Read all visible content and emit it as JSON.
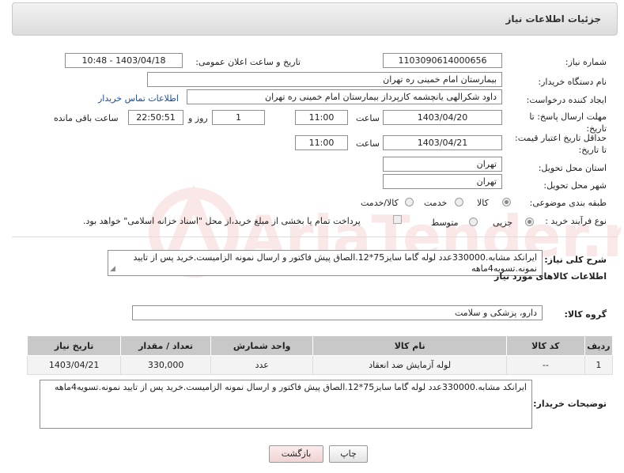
{
  "header": {
    "title": "جزئیات اطلاعات نیاز"
  },
  "form": {
    "need_number_label": "شماره نیاز:",
    "need_number": "1103090614000656",
    "announce_label": "تاریخ و ساعت اعلان عمومی:",
    "announce_value": "1403/04/18 - 10:48",
    "buyer_label": "نام دستگاه خریدار:",
    "buyer_value": "بیمارستان امام خمینی ره  تهران",
    "creator_label": "ایجاد کننده درخواست:",
    "creator_value": "داود شکرالهی یانچشمه کارپرداز بیمارستان امام خمینی ره  تهران",
    "contact_link": "اطلاعات تماس خریدار",
    "deadline_label": "مهلت ارسال پاسخ: تا تاریخ:",
    "deadline_date": "1403/04/20",
    "time_label": "ساعت",
    "deadline_time": "11:00",
    "days_value": "1",
    "day_and_label": "روز و",
    "remaining_time": "22:50:51",
    "remaining_label": "ساعت باقی مانده",
    "min_price_label": "حداقل تاریخ اعتبار قیمت: تا تاریخ:",
    "min_price_date": "1403/04/21",
    "min_price_time": "11:00",
    "province_label": "استان محل تحویل:",
    "province_value": "تهران",
    "city_label": "شهر محل تحویل:",
    "city_value": "تهران",
    "category_label": "طبقه بندی موضوعی:",
    "category_options": [
      "کالا",
      "خدمت",
      "کالا/خدمت"
    ],
    "category_selected": "کالا",
    "process_label": "نوع فرآیند خرید :",
    "process_options": [
      "جزیی",
      "متوسط"
    ],
    "process_selected": "جزیی",
    "payment_note": "پرداخت تمام یا بخشی از مبلغ خرید،از محل \"اسناد خزانه اسلامی\" خواهد بود."
  },
  "summary": {
    "label": "شرح کلی نیاز:",
    "text": "ایرانکد مشابه.330000عدد لوله گاما سایز75*12.الصاق پیش فاکتور و ارسال نمونه الزامیست.خرید پس از تایید نمونه.تسویه4ماهه"
  },
  "goods": {
    "section_title": "اطلاعات کالاهای مورد نیاز",
    "group_label": "گروه کالا:",
    "group_value": "دارو، پزشکی و سلامت",
    "columns": [
      "ردیف",
      "کد کالا",
      "نام کالا",
      "واحد شمارش",
      "تعداد / مقدار",
      "تاریخ نیاز"
    ],
    "rows": [
      [
        "1",
        "--",
        "لوله آزمایش ضد انعقاد",
        "عدد",
        "330,000",
        "1403/04/21"
      ]
    ]
  },
  "buyer_notes": {
    "label": "توضیحات خریدار:",
    "text": "ایرانکد مشابه.330000عدد لوله گاما سایز75*12.الصاق پیش فاکتور و ارسال نمونه الزامیست.خرید پس از تایید نمونه.تسویه4ماهه"
  },
  "buttons": {
    "print": "چاپ",
    "back": "بازگشت"
  },
  "watermark_text": "AriaTender.neT",
  "colors": {
    "link": "#1a4fa0",
    "header_bg": "#e6e6e6",
    "table_head": "#c8c8c8",
    "back_btn": "#f7dede",
    "watermark": "#d9534f"
  }
}
